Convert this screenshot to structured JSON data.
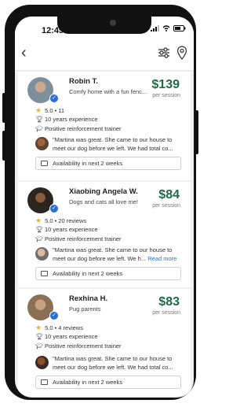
{
  "status_bar": {
    "time": "12:45"
  },
  "nav": {
    "back_icon": "chevron-left-icon",
    "filter_icon": "filter-sliders-icon",
    "map_icon": "map-pin-icon"
  },
  "colors": {
    "price": "#1f6b45",
    "link": "#2a6fd6",
    "star": "#f2b01e",
    "verified": "#2a6fd6"
  },
  "sitters": [
    {
      "name": "Robin T.",
      "tagline": "Comfy home with a fun fenc...",
      "price": "$139",
      "per_session": "per session",
      "rating": "5.0 • 11",
      "experience": "10 years experience",
      "trainer": "Positive reinforcement trainer",
      "review": "\"Martina was great. She came to our house to meet our dog before we left. We had total co...",
      "read_more": "",
      "availability": "Availability in next 2 weeks"
    },
    {
      "name": "Xiaobing Angela W.",
      "tagline": "Dogs and cats all love me!",
      "price": "$84",
      "per_session": "per session",
      "rating": "5.0 • 20 reviews",
      "experience": "10 years experience",
      "trainer": "Positive reinforcement trainer",
      "review": "\"Martina was great. She came to our house to meet our dog before we left. We h...",
      "read_more": "Read more",
      "availability": "Availability in next 2 weeks"
    },
    {
      "name": "Rexhina H.",
      "tagline": "Pug parents",
      "price": "$83",
      "per_session": "per session",
      "rating": "5.0 • 4 reviews",
      "experience": "10 years experience",
      "trainer": "Positive reinforcement trainer",
      "review": "\"Martina was great. She came to our house to meet our dog before we left. We had total co...",
      "read_more": "",
      "availability": "Availability in next 2 weeks"
    }
  ]
}
